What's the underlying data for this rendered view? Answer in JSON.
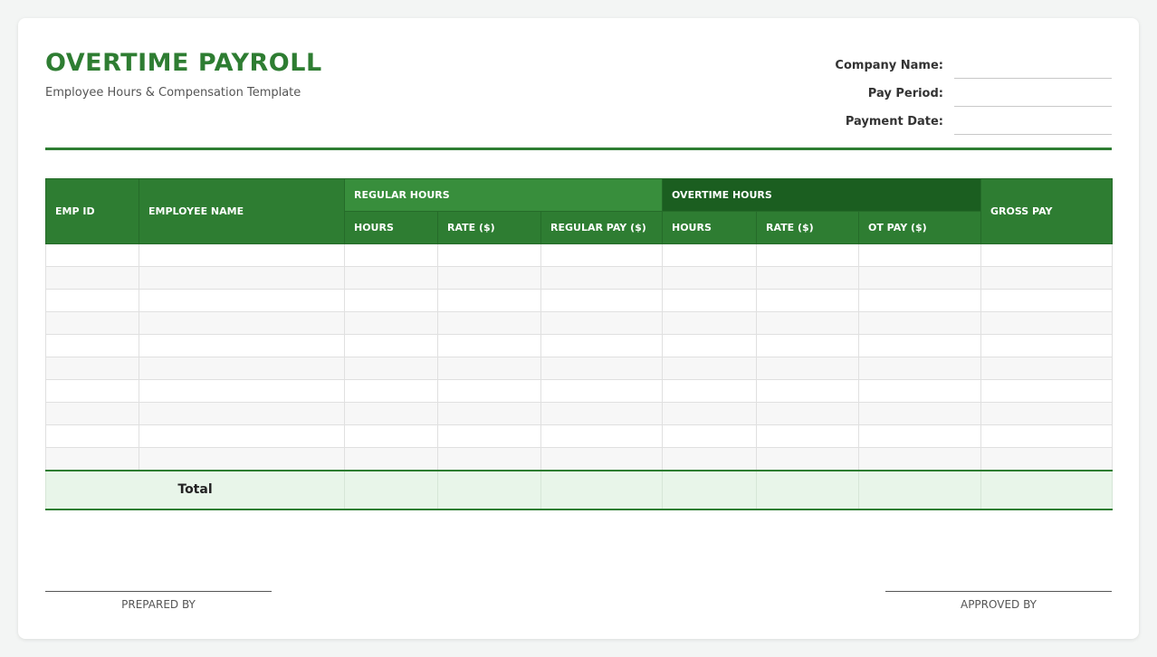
{
  "header": {
    "title": "OVERTIME PAYROLL",
    "subtitle": "Employee Hours & Compensation Template"
  },
  "meta": {
    "company_label": "Company Name:",
    "company_value": "",
    "pay_period_label": "Pay Period:",
    "pay_period_value": "",
    "payment_date_label": "Payment Date:",
    "payment_date_value": ""
  },
  "table": {
    "emp_id": "EMP ID",
    "employee_name": "EMPLOYEE NAME",
    "regular_group": "REGULAR HOURS",
    "overtime_group": "OVERTIME HOURS",
    "gross_pay": "GROSS PAY",
    "reg_hours": "HOURS",
    "reg_rate": "RATE ($)",
    "reg_pay": "REGULAR PAY ($)",
    "ot_hours": "HOURS",
    "ot_rate": "RATE ($)",
    "ot_pay": "OT PAY ($)",
    "total_label": "Total"
  },
  "signatures": {
    "prepared_by": "PREPARED BY",
    "approved_by": "APPROVED BY"
  },
  "colors": {
    "accent": "#2e7d32",
    "regular_header": "#388e3c",
    "overtime_header": "#1b5e20",
    "total_row": "#e8f5e9"
  }
}
